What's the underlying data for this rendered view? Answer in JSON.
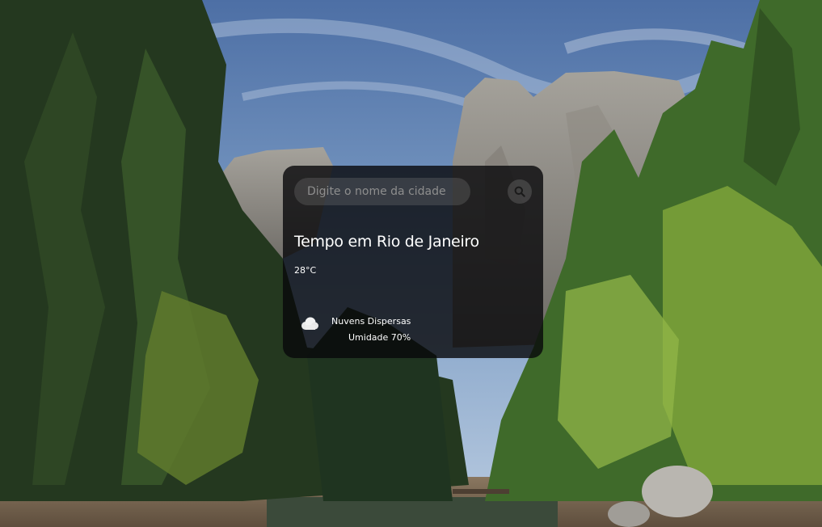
{
  "search": {
    "placeholder": "Digite o nome da cidade"
  },
  "icons": {
    "search": "search-icon",
    "weather": "cloud-icon"
  },
  "weather": {
    "title": "Tempo em Rio de Janeiro",
    "temperature": "28°C",
    "description": "Nuvens Dispersas",
    "humidity": "Umidade 70%"
  },
  "colors": {
    "card_background": "#08080a",
    "input_background": "#7c7c7c"
  }
}
